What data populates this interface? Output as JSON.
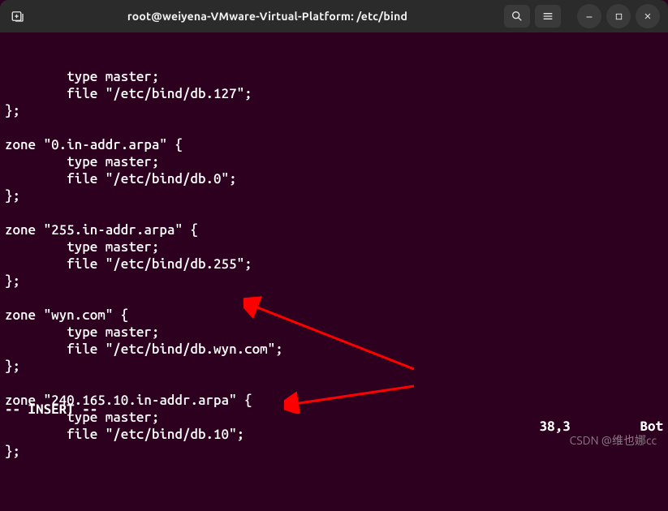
{
  "titlebar": {
    "title": "root@weiyena-VMware-Virtual-Platform: /etc/bind"
  },
  "terminal": {
    "lines": [
      "        type master;",
      "        file \"/etc/bind/db.127\";",
      "};",
      "",
      "zone \"0.in-addr.arpa\" {",
      "        type master;",
      "        file \"/etc/bind/db.0\";",
      "};",
      "",
      "zone \"255.in-addr.arpa\" {",
      "        type master;",
      "        file \"/etc/bind/db.255\";",
      "};",
      "",
      "zone \"wyn.com\" {",
      "        type master;",
      "        file \"/etc/bind/db.wyn.com\";",
      "};",
      "",
      "zone \"240.165.10.in-addr.arpa\" {",
      "        type master;",
      "        file \"/etc/bind/db.10\";",
      "};"
    ],
    "mode": "-- INSERT --",
    "cursor_pos": "38,3",
    "scroll_pos": "Bot"
  },
  "watermark": "CSDN @维也娜cc",
  "icons": {
    "new_tab": "⊕",
    "search": "⌕",
    "menu": "≡",
    "minimize": "–",
    "maximize": "□",
    "close": "✕"
  },
  "annotations": {
    "arrow_color": "#ff0000"
  }
}
